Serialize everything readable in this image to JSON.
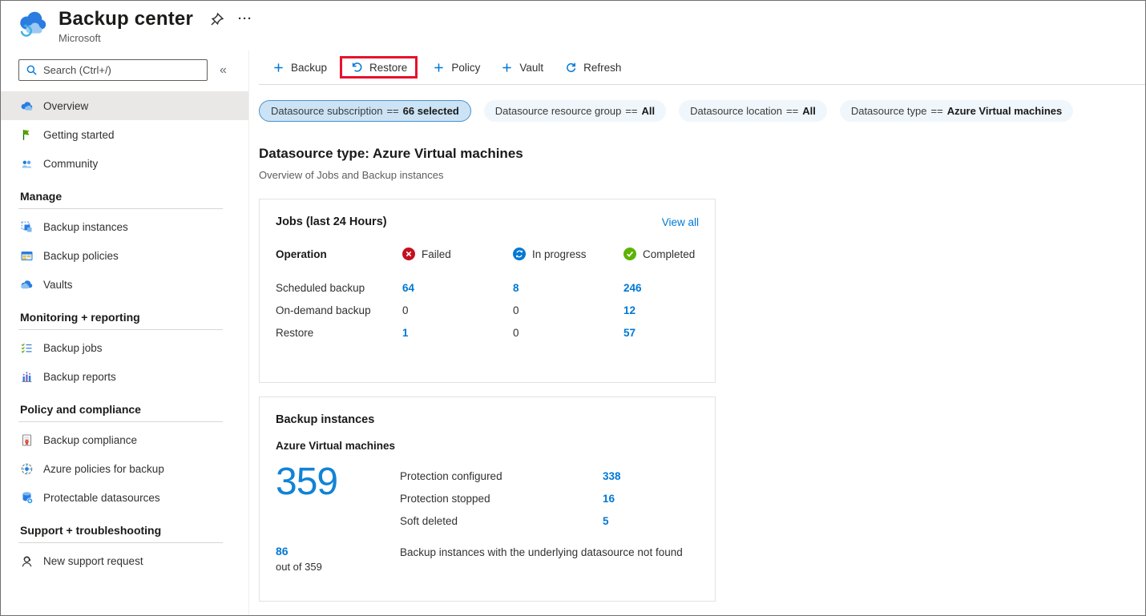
{
  "header": {
    "title": "Backup center",
    "subtitle": "Microsoft",
    "more_glyph": "···"
  },
  "sidebar": {
    "search_placeholder": "Search (Ctrl+/)",
    "collapse_glyph": "«",
    "sections": [
      {
        "items": [
          {
            "label": "Overview"
          },
          {
            "label": "Getting started"
          },
          {
            "label": "Community"
          }
        ]
      },
      {
        "header": "Manage",
        "items": [
          {
            "label": "Backup instances"
          },
          {
            "label": "Backup policies"
          },
          {
            "label": "Vaults"
          }
        ]
      },
      {
        "header": "Monitoring + reporting",
        "items": [
          {
            "label": "Backup jobs"
          },
          {
            "label": "Backup reports"
          }
        ]
      },
      {
        "header": "Policy and compliance",
        "items": [
          {
            "label": "Backup compliance"
          },
          {
            "label": "Azure policies for backup"
          },
          {
            "label": "Protectable datasources"
          }
        ]
      },
      {
        "header": "Support + troubleshooting",
        "items": [
          {
            "label": "New support request"
          }
        ]
      }
    ]
  },
  "toolbar": {
    "buttons": [
      {
        "label": "Backup"
      },
      {
        "label": "Restore"
      },
      {
        "label": "Policy"
      },
      {
        "label": "Vault"
      },
      {
        "label": "Refresh"
      }
    ]
  },
  "filters": [
    {
      "label": "Datasource subscription",
      "op": "==",
      "value": "66 selected",
      "selected": true
    },
    {
      "label": "Datasource resource group",
      "op": "==",
      "value": "All",
      "selected": false
    },
    {
      "label": "Datasource location",
      "op": "==",
      "value": "All",
      "selected": false
    },
    {
      "label": "Datasource type",
      "op": "==",
      "value": "Azure Virtual machines",
      "selected": false
    }
  ],
  "main": {
    "heading": "Datasource type: Azure Virtual machines",
    "subheading": "Overview of Jobs and Backup instances",
    "jobs_card": {
      "title": "Jobs (last 24 Hours)",
      "view_all": "View all",
      "columns": {
        "operation": "Operation",
        "failed": "Failed",
        "in_progress": "In progress",
        "completed": "Completed"
      },
      "rows": [
        {
          "operation": "Scheduled backup",
          "failed": "64",
          "in_progress": "8",
          "completed": "246"
        },
        {
          "operation": "On-demand backup",
          "failed": "0",
          "in_progress": "0",
          "completed": "12"
        },
        {
          "operation": "Restore",
          "failed": "1",
          "in_progress": "0",
          "completed": "57"
        }
      ]
    },
    "instances_card": {
      "title": "Backup instances",
      "subtitle": "Azure Virtual machines",
      "total": "359",
      "stats": [
        {
          "label": "Protection configured",
          "value": "338"
        },
        {
          "label": "Protection stopped",
          "value": "16"
        },
        {
          "label": "Soft deleted",
          "value": "5"
        }
      ],
      "not_found_count": "86",
      "not_found_sub": "out of 359",
      "not_found_label": "Backup instances with the underlying datasource not found"
    }
  },
  "colors": {
    "accent_blue": "#0078d4",
    "highlight_red": "#e8112d",
    "failed_red": "#c50f1f",
    "in_progress_blue": "#0078d4",
    "completed_green": "#5db300",
    "selected_pill_bg": "#cbe3f5",
    "selected_nav_bg": "#e9e8e6"
  }
}
